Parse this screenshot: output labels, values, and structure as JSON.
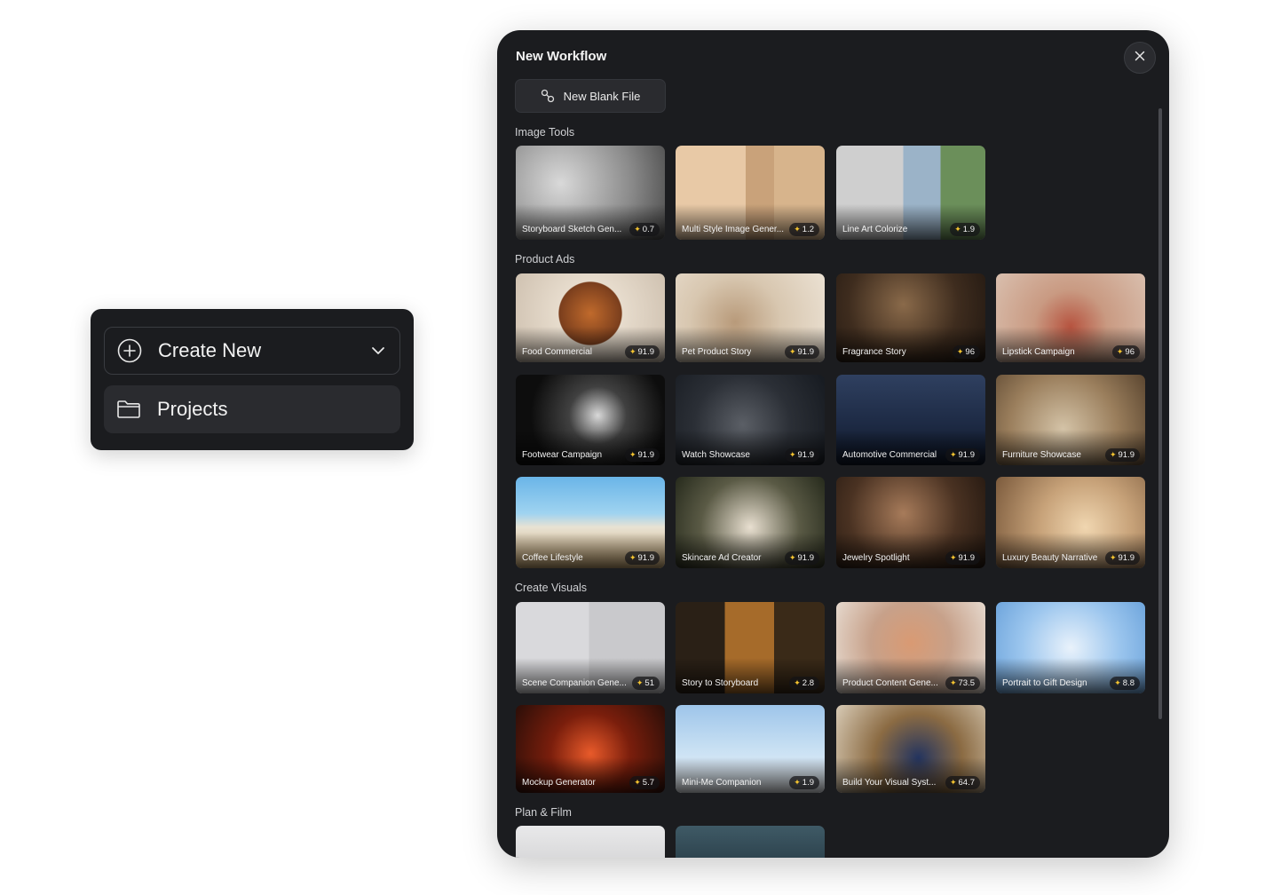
{
  "menu": {
    "create_new": "Create New",
    "projects": "Projects"
  },
  "workflow": {
    "title": "New Workflow",
    "new_blank_file": "New Blank File",
    "sections": {
      "image_tools": "Image Tools",
      "product_ads": "Product Ads",
      "create_visuals": "Create Visuals",
      "plan_film": "Plan & Film"
    },
    "image_tools": [
      {
        "name": "Storyboard Sketch Gen...",
        "score": "0.7"
      },
      {
        "name": "Multi Style Image Gener...",
        "score": "1.2"
      },
      {
        "name": "Line Art Colorize",
        "score": "1.9"
      }
    ],
    "product_ads": [
      {
        "name": "Food Commercial",
        "score": "91.9"
      },
      {
        "name": "Pet Product Story",
        "score": "91.9"
      },
      {
        "name": "Fragrance Story",
        "score": "96"
      },
      {
        "name": "Lipstick Campaign",
        "score": "96"
      },
      {
        "name": "Footwear Campaign",
        "score": "91.9"
      },
      {
        "name": "Watch Showcase",
        "score": "91.9"
      },
      {
        "name": "Automotive Commercial",
        "score": "91.9"
      },
      {
        "name": "Furniture Showcase",
        "score": "91.9"
      },
      {
        "name": "Coffee Lifestyle",
        "score": "91.9"
      },
      {
        "name": "Skincare Ad Creator",
        "score": "91.9"
      },
      {
        "name": "Jewelry Spotlight",
        "score": "91.9"
      },
      {
        "name": "Luxury Beauty Narrative",
        "score": "91.9"
      }
    ],
    "create_visuals": [
      {
        "name": "Scene Companion Gene...",
        "score": "51"
      },
      {
        "name": "Story to Storyboard",
        "score": "2.8"
      },
      {
        "name": "Product Content Gene...",
        "score": "73.5"
      },
      {
        "name": "Portrait to Gift Design",
        "score": "8.8"
      },
      {
        "name": "Mockup Generator",
        "score": "5.7"
      },
      {
        "name": "Mini-Me Companion",
        "score": "1.9"
      },
      {
        "name": "Build Your Visual Syst...",
        "score": "64.7"
      }
    ]
  }
}
